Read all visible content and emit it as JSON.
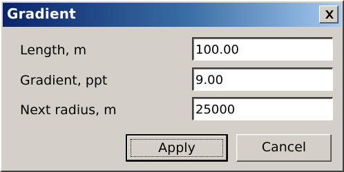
{
  "window": {
    "title": "Gradient",
    "close_glyph": "✕",
    "colors": {
      "titlebar_start": "#0a246a",
      "titlebar_end": "#a6caf0",
      "face": "#d4d0c8"
    }
  },
  "fields": [
    {
      "label": "Length, m",
      "value": "100.00"
    },
    {
      "label": "Gradient, ppt",
      "value": "9.00"
    },
    {
      "label": "Next radius, m",
      "value": "25000"
    }
  ],
  "buttons": {
    "apply_label": "Apply",
    "cancel_label": "Cancel"
  },
  "icons": {
    "close": "close-icon"
  }
}
